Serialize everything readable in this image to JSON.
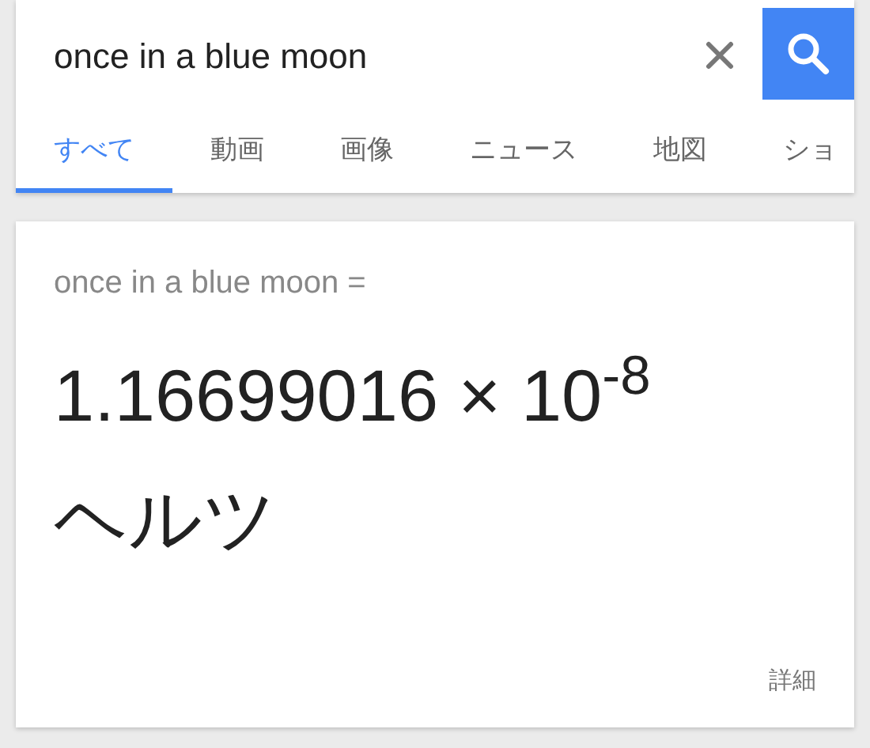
{
  "search": {
    "value": "once in a blue moon"
  },
  "tabs": [
    {
      "label": "すべて",
      "selected": true
    },
    {
      "label": "動画",
      "selected": false
    },
    {
      "label": "画像",
      "selected": false
    },
    {
      "label": "ニュース",
      "selected": false
    },
    {
      "label": "地図",
      "selected": false
    },
    {
      "label": "ショ",
      "selected": false
    }
  ],
  "result": {
    "query": "once in a blue moon =",
    "value": "1.16699016 × 10$^{-8}$",
    "unit": "ヘルツ",
    "more_link": "詳細"
  }
}
